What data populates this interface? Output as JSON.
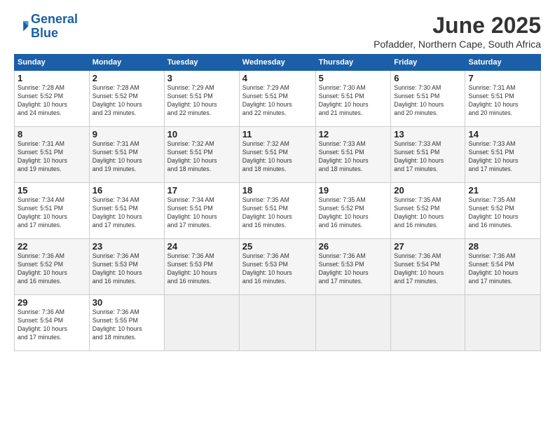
{
  "logo": {
    "line1": "General",
    "line2": "Blue"
  },
  "title": "June 2025",
  "location": "Pofadder, Northern Cape, South Africa",
  "columns": [
    "Sunday",
    "Monday",
    "Tuesday",
    "Wednesday",
    "Thursday",
    "Friday",
    "Saturday"
  ],
  "weeks": [
    [
      {
        "day": "1",
        "info": "Sunrise: 7:28 AM\nSunset: 5:52 PM\nDaylight: 10 hours\nand 24 minutes."
      },
      {
        "day": "2",
        "info": "Sunrise: 7:28 AM\nSunset: 5:52 PM\nDaylight: 10 hours\nand 23 minutes."
      },
      {
        "day": "3",
        "info": "Sunrise: 7:29 AM\nSunset: 5:51 PM\nDaylight: 10 hours\nand 22 minutes."
      },
      {
        "day": "4",
        "info": "Sunrise: 7:29 AM\nSunset: 5:51 PM\nDaylight: 10 hours\nand 22 minutes."
      },
      {
        "day": "5",
        "info": "Sunrise: 7:30 AM\nSunset: 5:51 PM\nDaylight: 10 hours\nand 21 minutes."
      },
      {
        "day": "6",
        "info": "Sunrise: 7:30 AM\nSunset: 5:51 PM\nDaylight: 10 hours\nand 20 minutes."
      },
      {
        "day": "7",
        "info": "Sunrise: 7:31 AM\nSunset: 5:51 PM\nDaylight: 10 hours\nand 20 minutes."
      }
    ],
    [
      {
        "day": "8",
        "info": "Sunrise: 7:31 AM\nSunset: 5:51 PM\nDaylight: 10 hours\nand 19 minutes."
      },
      {
        "day": "9",
        "info": "Sunrise: 7:31 AM\nSunset: 5:51 PM\nDaylight: 10 hours\nand 19 minutes."
      },
      {
        "day": "10",
        "info": "Sunrise: 7:32 AM\nSunset: 5:51 PM\nDaylight: 10 hours\nand 18 minutes."
      },
      {
        "day": "11",
        "info": "Sunrise: 7:32 AM\nSunset: 5:51 PM\nDaylight: 10 hours\nand 18 minutes."
      },
      {
        "day": "12",
        "info": "Sunrise: 7:33 AM\nSunset: 5:51 PM\nDaylight: 10 hours\nand 18 minutes."
      },
      {
        "day": "13",
        "info": "Sunrise: 7:33 AM\nSunset: 5:51 PM\nDaylight: 10 hours\nand 17 minutes."
      },
      {
        "day": "14",
        "info": "Sunrise: 7:33 AM\nSunset: 5:51 PM\nDaylight: 10 hours\nand 17 minutes."
      }
    ],
    [
      {
        "day": "15",
        "info": "Sunrise: 7:34 AM\nSunset: 5:51 PM\nDaylight: 10 hours\nand 17 minutes."
      },
      {
        "day": "16",
        "info": "Sunrise: 7:34 AM\nSunset: 5:51 PM\nDaylight: 10 hours\nand 17 minutes."
      },
      {
        "day": "17",
        "info": "Sunrise: 7:34 AM\nSunset: 5:51 PM\nDaylight: 10 hours\nand 17 minutes."
      },
      {
        "day": "18",
        "info": "Sunrise: 7:35 AM\nSunset: 5:51 PM\nDaylight: 10 hours\nand 16 minutes."
      },
      {
        "day": "19",
        "info": "Sunrise: 7:35 AM\nSunset: 5:52 PM\nDaylight: 10 hours\nand 16 minutes."
      },
      {
        "day": "20",
        "info": "Sunrise: 7:35 AM\nSunset: 5:52 PM\nDaylight: 10 hours\nand 16 minutes."
      },
      {
        "day": "21",
        "info": "Sunrise: 7:35 AM\nSunset: 5:52 PM\nDaylight: 10 hours\nand 16 minutes."
      }
    ],
    [
      {
        "day": "22",
        "info": "Sunrise: 7:36 AM\nSunset: 5:52 PM\nDaylight: 10 hours\nand 16 minutes."
      },
      {
        "day": "23",
        "info": "Sunrise: 7:36 AM\nSunset: 5:53 PM\nDaylight: 10 hours\nand 16 minutes."
      },
      {
        "day": "24",
        "info": "Sunrise: 7:36 AM\nSunset: 5:53 PM\nDaylight: 10 hours\nand 16 minutes."
      },
      {
        "day": "25",
        "info": "Sunrise: 7:36 AM\nSunset: 5:53 PM\nDaylight: 10 hours\nand 16 minutes."
      },
      {
        "day": "26",
        "info": "Sunrise: 7:36 AM\nSunset: 5:53 PM\nDaylight: 10 hours\nand 17 minutes."
      },
      {
        "day": "27",
        "info": "Sunrise: 7:36 AM\nSunset: 5:54 PM\nDaylight: 10 hours\nand 17 minutes."
      },
      {
        "day": "28",
        "info": "Sunrise: 7:36 AM\nSunset: 5:54 PM\nDaylight: 10 hours\nand 17 minutes."
      }
    ],
    [
      {
        "day": "29",
        "info": "Sunrise: 7:36 AM\nSunset: 5:54 PM\nDaylight: 10 hours\nand 17 minutes."
      },
      {
        "day": "30",
        "info": "Sunrise: 7:36 AM\nSunset: 5:55 PM\nDaylight: 10 hours\nand 18 minutes."
      },
      null,
      null,
      null,
      null,
      null
    ]
  ]
}
